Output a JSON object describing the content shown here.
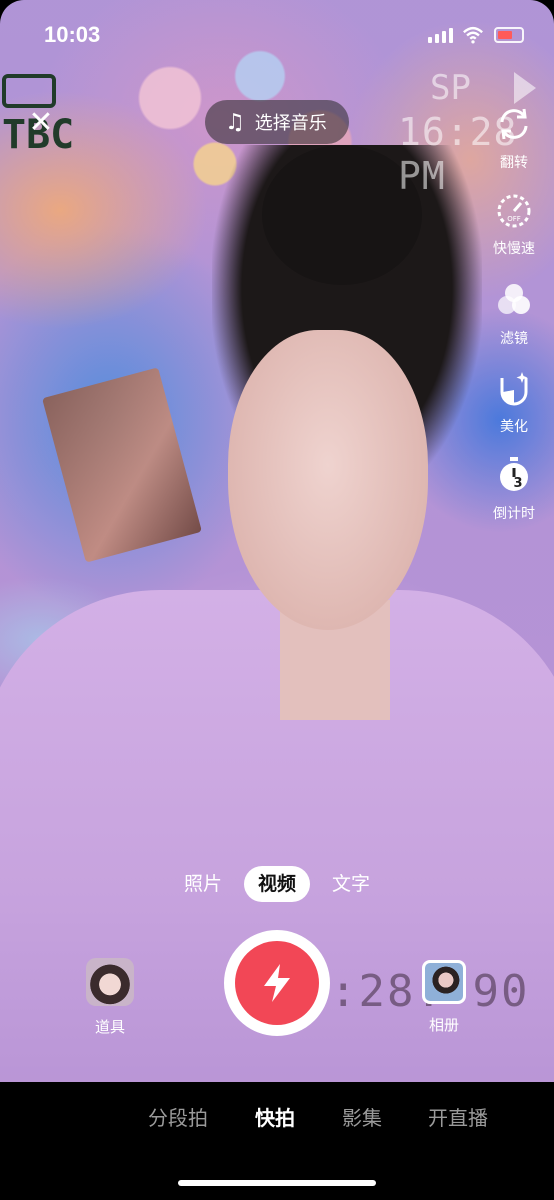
{
  "status_bar": {
    "time": "10:03"
  },
  "top": {
    "close_icon": "close-icon",
    "music_label": "选择音乐"
  },
  "overlay_text": {
    "sp": "SP",
    "clock": "16:28 PM",
    "tbc": "TBC",
    "counter": ":28.  90"
  },
  "toolbar": [
    {
      "label": "翻转",
      "icon": "flip-camera-icon"
    },
    {
      "label": "快慢速",
      "icon": "speed-icon",
      "badge": "OFF"
    },
    {
      "label": "滤镜",
      "icon": "filter-icon"
    },
    {
      "label": "美化",
      "icon": "beauty-icon"
    },
    {
      "label": "倒计时",
      "icon": "timer-icon",
      "badge": "3"
    }
  ],
  "modes": {
    "items": [
      "照片",
      "视频",
      "文字"
    ],
    "selected": "视频"
  },
  "capture": {
    "props_label": "道具",
    "album_label": "相册"
  },
  "bottom_nav": {
    "items": [
      "分段拍",
      "快拍",
      "影集",
      "开直播"
    ],
    "selected": "快拍"
  },
  "colors": {
    "shutter": "#f24756",
    "accent": "#ffffff"
  }
}
